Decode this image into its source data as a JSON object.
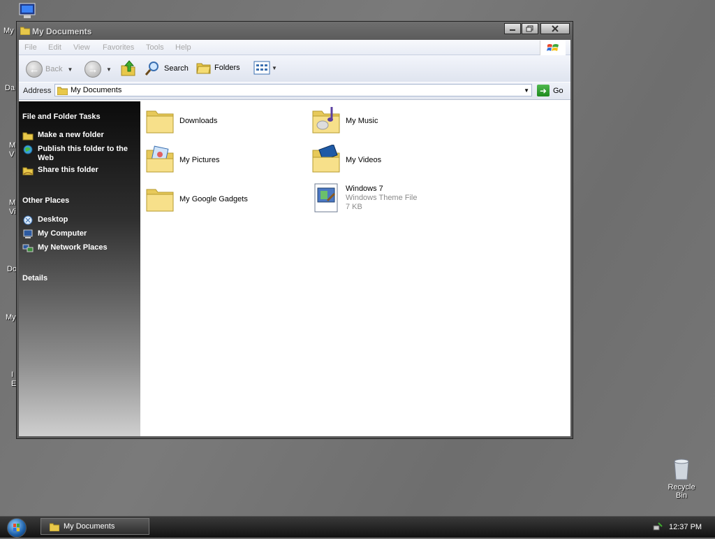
{
  "desktop": {
    "left_labels": [
      "My",
      "Da",
      "M\nV",
      "M\nVi",
      "Do",
      "My",
      "I\nE"
    ],
    "recycle_bin": "Recycle Bin"
  },
  "window": {
    "title": "My Documents",
    "menu": [
      "File",
      "Edit",
      "View",
      "Favorites",
      "Tools",
      "Help"
    ],
    "toolbar": {
      "back": "Back",
      "search": "Search",
      "folders": "Folders"
    },
    "address": {
      "label": "Address",
      "value": "My Documents",
      "go": "Go"
    },
    "sidebar": {
      "tasks_header": "File and Folder Tasks",
      "tasks": [
        "Make a new folder",
        "Publish this folder to the Web",
        "Share this folder"
      ],
      "places_header": "Other Places",
      "places": [
        "Desktop",
        "My Computer",
        "My Network Places"
      ],
      "details_header": "Details"
    },
    "files": [
      {
        "name": "Downloads",
        "icon": "folder-icon"
      },
      {
        "name": "My Music",
        "icon": "music-folder-icon"
      },
      {
        "name": "My Pictures",
        "icon": "pictures-folder-icon"
      },
      {
        "name": "My Videos",
        "icon": "videos-folder-icon"
      },
      {
        "name": "My Google Gadgets",
        "icon": "folder-icon"
      },
      {
        "name": "Windows 7",
        "type": "Windows Theme File",
        "size": "7 KB",
        "icon": "theme-file-icon"
      }
    ]
  },
  "taskbar": {
    "task": "My Documents",
    "clock": "12:37 PM"
  }
}
